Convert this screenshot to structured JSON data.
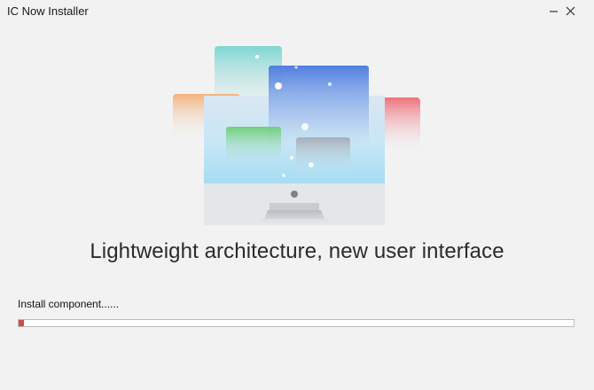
{
  "window": {
    "title": "IC Now Installer"
  },
  "content": {
    "headline": "Lightweight architecture, new user interface",
    "status": "Install component......"
  },
  "progress": {
    "value_percent": 1,
    "fill_color": "#d24b4b"
  },
  "icons": {
    "minimize": "minimize-icon",
    "close": "close-icon",
    "hero": "monitor-illustration"
  }
}
